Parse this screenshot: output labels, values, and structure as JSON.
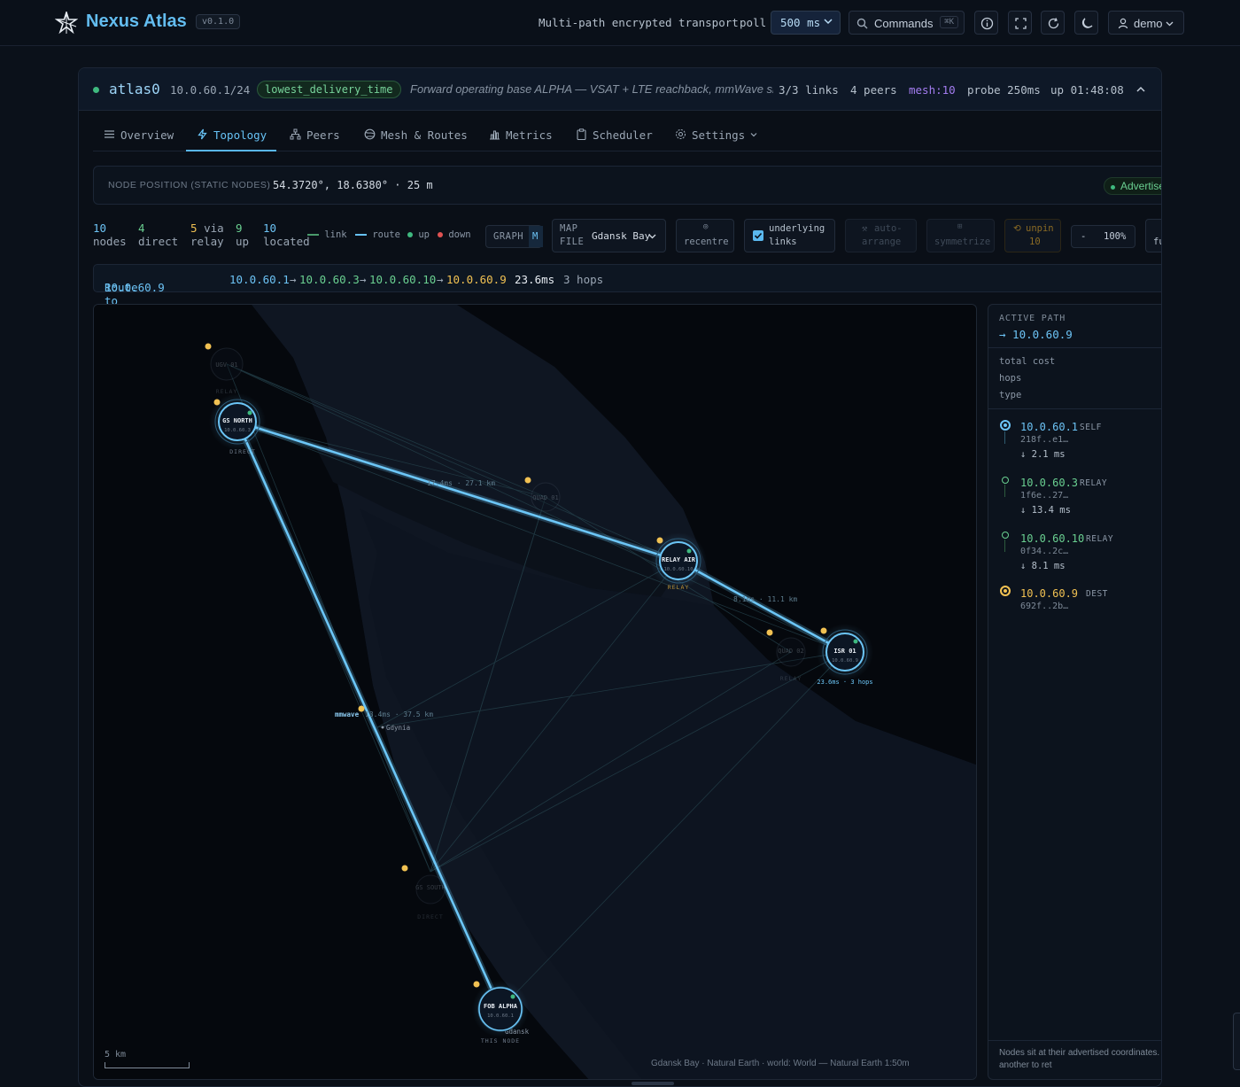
{
  "app": {
    "title": "Nexus Atlas",
    "version": "v0.1.0",
    "tagline": "Multi-path encrypted transport",
    "poll_label": "poll",
    "poll_value": "500 ms",
    "commands_label": "Commands",
    "commands_shortcut": "⌘K",
    "user": "demo"
  },
  "interface": {
    "name": "atlas0",
    "address": "10.0.60.1/24",
    "policy": "lowest_delivery_time",
    "description": "Forward operating base ALPHA — VSAT + LTE reachback, mmWave sh…",
    "links": "3/3 links",
    "peers": "4 peers",
    "mesh": "mesh:10",
    "probe": "probe 250ms",
    "uptime": "up 01:48:08"
  },
  "tabs": [
    {
      "label": "Overview"
    },
    {
      "label": "Topology"
    },
    {
      "label": "Peers"
    },
    {
      "label": "Mesh & Routes"
    },
    {
      "label": "Metrics"
    },
    {
      "label": "Scheduler"
    },
    {
      "label": "Settings"
    }
  ],
  "position": {
    "label": "NODE POSITION (STATIC NODES)",
    "value": "54.3720°, 18.6380°  ·  25 m",
    "badge": "Advertised"
  },
  "stats": [
    {
      "value": "10",
      "label": "nodes"
    },
    {
      "value": "4",
      "label": "direct"
    },
    {
      "value": "5",
      "suffix": "via",
      "label": "relay"
    },
    {
      "value": "9",
      "label": "up"
    },
    {
      "value": "10",
      "label": "located"
    }
  ],
  "legend": {
    "link": "link",
    "route": "route",
    "up": "up",
    "down": "down"
  },
  "controls": {
    "graph": "GRAPH",
    "map_short": "M",
    "map": "MAP",
    "file": "FILE",
    "map_file": "Gdansk Bay",
    "recentre": "recentre",
    "underlying_1": "underlying",
    "underlying_2": "links",
    "auto_1": "auto-",
    "auto_2": "arrange",
    "symmetrize": "symmetrize",
    "unpin_1": "unpin",
    "unpin_2": "10",
    "zoom_minus": "-",
    "zoom": "100%",
    "full": "fu"
  },
  "route": {
    "label": "Route to",
    "dest": "10.0.60.9",
    "h1": "10.0.60.1",
    "h2": "10.0.60.3",
    "h3": "10.0.60.10",
    "h4": "10.0.60.9",
    "latency": "23.6ms",
    "hops": "3 hops"
  },
  "map": {
    "nodes": [
      {
        "name": "GS NORTH",
        "ip": "10.0.60.3",
        "role": "DIRECT"
      },
      {
        "name": "RELAY AIR",
        "ip": "10.0.60.10",
        "role": "RELAY"
      },
      {
        "name": "ISR 01",
        "ip": "10.0.60.9",
        "role": "23.6ms · 3 hops"
      },
      {
        "name": "FOB ALPHA",
        "ip": "10.0.60.1",
        "role": "THIS NODE"
      },
      {
        "name": "UGV 01",
        "ip": "",
        "role": "RELAY"
      },
      {
        "name": "QUAD 01",
        "ip": "",
        "role": ""
      },
      {
        "name": "QUAD 02",
        "ip": "",
        "role": "RELAY"
      },
      {
        "name": "GS SOUTH",
        "ip": "",
        "role": "DIRECT"
      }
    ],
    "edge_labels": {
      "a": "17.4ms · 27.1 km",
      "b": "8.1ms · 11.1 km",
      "c_tag": "mmwave",
      "c": "13.4ms · 37.5 km"
    },
    "places": {
      "gdynia": "Gdynia",
      "gdansk": "Gdansk"
    },
    "scale": "5 km",
    "footer": "Gdansk Bay  ·  Natural Earth  ·  world: World — Natural Earth 1:50m"
  },
  "active_path": {
    "heading": "ACTIVE PATH",
    "dest": "→ 10.0.60.9",
    "rows": [
      "total cost",
      "hops",
      "type"
    ],
    "hops": [
      {
        "ip": "10.0.60.1",
        "role": "SELF",
        "key": "218f..e1…",
        "latency": "↓ 2.1 ms"
      },
      {
        "ip": "10.0.60.3",
        "role": "RELAY",
        "key": "1f6e..27…",
        "latency": "↓ 13.4 ms"
      },
      {
        "ip": "10.0.60.10",
        "role": "RELAY",
        "key": "0f34..2c…",
        "latency": "↓ 8.1 ms"
      },
      {
        "ip": "10.0.60.9",
        "role": "DEST",
        "key": "692f..2b…",
        "latency": ""
      }
    ],
    "note": "Nodes sit at their advertised coordinates. Click another to ret"
  }
}
